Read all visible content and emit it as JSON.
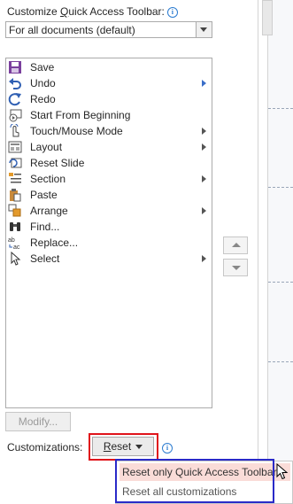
{
  "header": {
    "title_pre": "Customize ",
    "title_hotkey": "Q",
    "title_post": "uick Access Toolbar:",
    "info_symbol": "i"
  },
  "scope_dropdown": {
    "value": "For all documents (default)"
  },
  "commands": [
    {
      "label": "Save",
      "icon": "save-icon",
      "submenu": false
    },
    {
      "label": "Undo",
      "icon": "undo-icon",
      "submenu": true
    },
    {
      "label": "Redo",
      "icon": "redo-icon",
      "submenu": false
    },
    {
      "label": "Start From Beginning",
      "icon": "slideshow-icon",
      "submenu": false
    },
    {
      "label": "Touch/Mouse Mode",
      "icon": "touch-icon",
      "submenu": true
    },
    {
      "label": "Layout",
      "icon": "layout-icon",
      "submenu": true
    },
    {
      "label": "Reset Slide",
      "icon": "reset-slide-icon",
      "submenu": false
    },
    {
      "label": "Section",
      "icon": "section-icon",
      "submenu": true
    },
    {
      "label": "Paste",
      "icon": "paste-icon",
      "submenu": false
    },
    {
      "label": "Arrange",
      "icon": "arrange-icon",
      "submenu": true
    },
    {
      "label": "Find...",
      "icon": "binoculars-icon",
      "submenu": false
    },
    {
      "label": "Replace...",
      "icon": "replace-icon",
      "submenu": false
    },
    {
      "label": "Select",
      "icon": "cursor-icon",
      "submenu": true
    }
  ],
  "buttons": {
    "modify": "Modify...",
    "reset_hotkey": "R",
    "reset_rest": "eset"
  },
  "customizations_label": "Customizations:",
  "reset_menu": {
    "items": [
      "Reset only Quick Access Toolbar",
      "Reset all customizations"
    ]
  },
  "colors": {
    "accent_red": "#e0141b",
    "accent_blue": "#2a2ac8",
    "highlight": "#fadcd8"
  }
}
